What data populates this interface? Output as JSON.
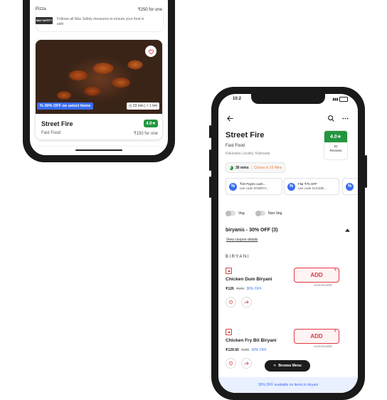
{
  "phone1": {
    "prev_card": {
      "cuisine": "Pizza",
      "price": "₹250 for one",
      "safety_logo_text": "MAX SAFETY",
      "safety_text": "Follows all Max Safety measures to ensure your food is safe"
    },
    "card": {
      "offer": "30% OFF on select items",
      "time_distance": "23 min | < 1 km",
      "name": "Street Fire",
      "rating": "4.0★",
      "cuisine": "Fast Food",
      "price": "₹150 for one"
    }
  },
  "phone2": {
    "status_time": "10:2",
    "restaurant": {
      "name": "Street Fire",
      "cuisine": "Fast Food",
      "location": "Kakinada Locality, Kakinada",
      "rating": "4.0★",
      "reviews_count": "52",
      "reviews_label": "Reviews"
    },
    "timing": {
      "time": "30 mins",
      "status": "Closes in 15 Mins"
    },
    "offers": [
      {
        "line1": "₹30 Paytm cash...",
        "line2": "use code ZOMPAY..."
      },
      {
        "line1": "Flat ₹75 OFF",
        "line2": "use code SUCEBI..."
      }
    ],
    "filters": {
      "veg": "Veg",
      "non_veg": "Non-Veg"
    },
    "section": {
      "title": "biryanis - 30% OFF (3)",
      "coupon_link": "View coupon details",
      "subheading": "BIRYANI"
    },
    "items": [
      {
        "name": "Chicken Dum Biryani",
        "price": "₹126",
        "original_price": "₹180",
        "discount": "30% OFF",
        "add": "ADD",
        "plus": "+",
        "note": "customisable"
      },
      {
        "name": "Chicken Fry Bit Biryani",
        "price": "₹129.50",
        "original_price": "₹185",
        "discount": "30% OFF",
        "add": "ADD",
        "plus": "+",
        "note": "customisable"
      }
    ],
    "browse_menu": "Browse Menu",
    "bottom_banner": "30% OFF available on items in biryani"
  },
  "colors": {
    "rating_green": "#24963f",
    "accent_red": "#e23744",
    "offer_blue": "#3a6df0"
  }
}
